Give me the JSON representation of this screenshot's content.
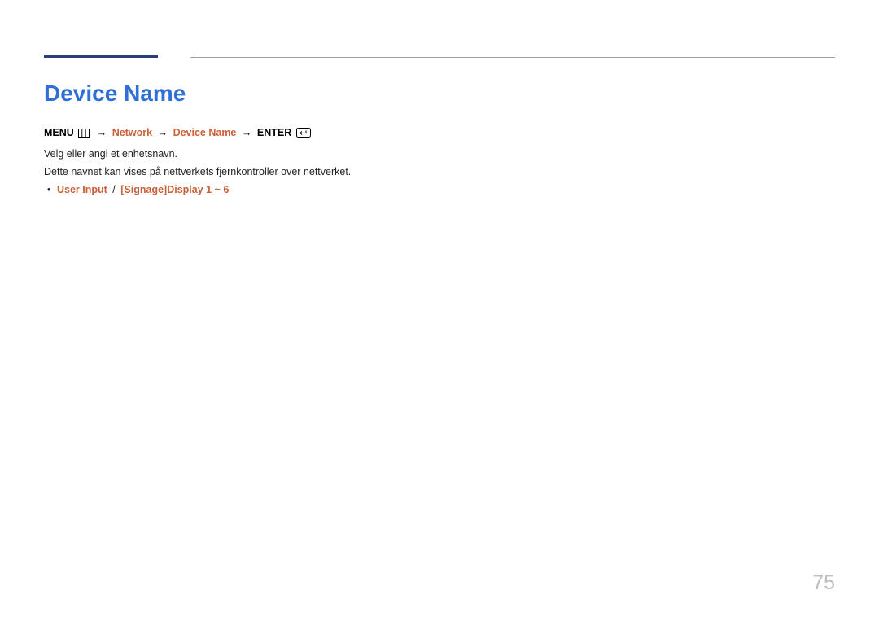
{
  "title": "Device Name",
  "breadcrumb": {
    "menu_label": "MENU",
    "arrow": "→",
    "network": "Network",
    "device_name": "Device Name",
    "enter_label": "ENTER"
  },
  "body": {
    "line1": "Velg eller angi et enhetsnavn.",
    "line2": "Dette navnet kan vises på nettverkets fjernkontroller over nettverket."
  },
  "options": {
    "user_input": "User Input",
    "separator": "/",
    "range": "[Signage]Display 1 ~ 6"
  },
  "page_number": "75"
}
